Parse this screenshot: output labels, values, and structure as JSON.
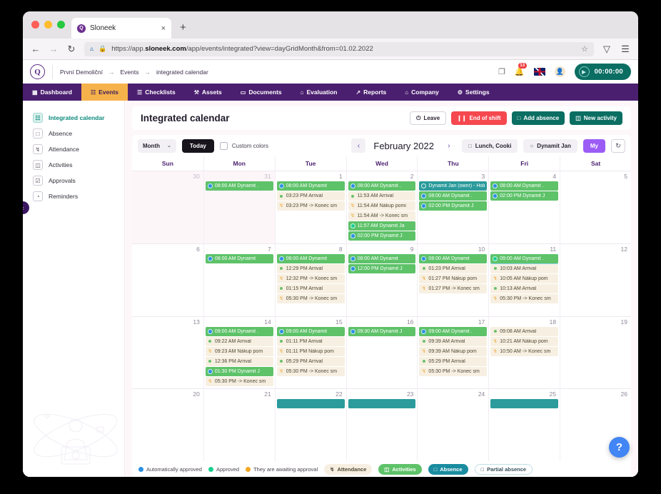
{
  "browser": {
    "tab_title": "Sloneek",
    "tab_close": "×",
    "new_tab": "+",
    "back": "←",
    "forward": "→",
    "reload": "↻",
    "url_prefix": "https://app.",
    "url_domain": "sloneek.com",
    "url_suffix": "/app/events/integrated?view=dayGridMonth&from=01.02.2022",
    "star": "☆",
    "pocket": "▽",
    "menu": "☰"
  },
  "appbar": {
    "logo": "Q",
    "breadcrumbs": [
      "První Demoliční",
      "Events",
      "integrated calendar"
    ],
    "arrow": "→",
    "chat_icon": "❐",
    "bell_icon": "△",
    "bell_badge": "13",
    "timer_value": "00:00:00",
    "play_icon": "▶"
  },
  "mainnav": [
    {
      "label": "Dashboard",
      "icon": "▦",
      "active": false
    },
    {
      "label": "Events",
      "icon": "☷",
      "active": true
    },
    {
      "label": "Checklists",
      "icon": "☰",
      "active": false
    },
    {
      "label": "Assets",
      "icon": "⚒",
      "active": false
    },
    {
      "label": "Documents",
      "icon": "▭",
      "active": false
    },
    {
      "label": "Evaluation",
      "icon": "⌂",
      "active": false
    },
    {
      "label": "Reports",
      "icon": "↗",
      "active": false
    },
    {
      "label": "Company",
      "icon": "⌂",
      "active": false
    },
    {
      "label": "Settings",
      "icon": "⚙",
      "active": false
    }
  ],
  "sidebar": {
    "items": [
      {
        "label": "Integrated calendar",
        "icon": "☷",
        "active": true
      },
      {
        "label": "Absence",
        "icon": "□",
        "active": false
      },
      {
        "label": "Attendance",
        "icon": "↯",
        "active": false
      },
      {
        "label": "Activities",
        "icon": "◫",
        "active": false
      },
      {
        "label": "Approvals",
        "icon": "☑",
        "active": false
      },
      {
        "label": "Reminders",
        "icon": "◔",
        "active": false
      }
    ],
    "collapse_icon": "‹"
  },
  "header": {
    "title": "Integrated calendar",
    "buttons": [
      {
        "label": "Leave",
        "icon": "⏻",
        "style": "outline"
      },
      {
        "label": "End of shift",
        "icon": "❙❙",
        "style": "red"
      },
      {
        "label": "Add absence",
        "icon": "□",
        "style": "teal"
      },
      {
        "label": "New activity",
        "icon": "◫",
        "style": "teal"
      }
    ]
  },
  "toolbar": {
    "view_select": "Month",
    "chevron": "⌄",
    "today_label": "Today",
    "custom_colors_label": "Custom colors",
    "prev_icon": "‹",
    "next_icon": "›",
    "month_label": "February 2022",
    "filter_pills": [
      {
        "label": "Lunch, Cooki",
        "icon": "□"
      },
      {
        "label": "Dynamit Jan",
        "icon": "○"
      }
    ],
    "my_label": "My",
    "refresh_icon": "↻"
  },
  "calendar": {
    "day_headers": [
      "Sun",
      "Mon",
      "Tue",
      "Wed",
      "Thu",
      "Fri",
      "Sat"
    ],
    "weeks": [
      {
        "days": [
          {
            "num": "30",
            "other": true,
            "events": []
          },
          {
            "num": "31",
            "other": true,
            "events": [
              {
                "type": "activity",
                "marker": "blue",
                "text": "08:00 AM Dynamit ."
              }
            ]
          },
          {
            "num": "1",
            "other": false,
            "events": [
              {
                "type": "activity",
                "marker": "blue",
                "text": "08:00 AM Dynamit"
              },
              {
                "type": "attend",
                "marker": "dotg",
                "text": "03:23 PM Arrival"
              },
              {
                "type": "attend",
                "marker": "run",
                "text": "03:23 PM -> Konec sm"
              }
            ]
          },
          {
            "num": "2",
            "other": false,
            "events": [
              {
                "type": "activity",
                "marker": "blue",
                "text": "08:00 AM Dynamit ."
              },
              {
                "type": "attend",
                "marker": "dotg",
                "text": "11:53 AM Arrival"
              },
              {
                "type": "attend",
                "marker": "run",
                "text": "11:54 AM Nákup pomi"
              },
              {
                "type": "attend",
                "marker": "run",
                "text": "11:54 AM -> Konec sm"
              },
              {
                "type": "activity",
                "marker": "green",
                "text": "11:57 AM Dynamit Ja"
              },
              {
                "type": "activity",
                "marker": "blue",
                "text": "02:00 PM Dynamit J"
              }
            ]
          },
          {
            "num": "3",
            "other": false,
            "events": [
              {
                "type": "absence",
                "marker": "hollow",
                "text": "Dynamit Jan (ownr) - Holiday"
              },
              {
                "type": "activity",
                "marker": "blue",
                "text": "08:00 AM Dynamit ."
              },
              {
                "type": "activity",
                "marker": "blue",
                "text": "02:00 PM Dynamit J"
              }
            ]
          },
          {
            "num": "4",
            "other": false,
            "events": [
              {
                "type": "activity",
                "marker": "blue",
                "text": "08:00 AM Dynamit ."
              },
              {
                "type": "activity",
                "marker": "blue",
                "text": "02:00 PM Dynamit J"
              }
            ]
          },
          {
            "num": "5",
            "other": false,
            "events": []
          }
        ]
      },
      {
        "days": [
          {
            "num": "6",
            "other": false,
            "events": []
          },
          {
            "num": "7",
            "other": false,
            "events": [
              {
                "type": "activity",
                "marker": "blue",
                "text": "08:00 AM Dynamit"
              }
            ]
          },
          {
            "num": "8",
            "other": false,
            "events": [
              {
                "type": "activity",
                "marker": "blue",
                "text": "08:00 AM Dynamit"
              },
              {
                "type": "attend",
                "marker": "dotg",
                "text": "12:29 PM Arrival"
              },
              {
                "type": "attend",
                "marker": "run",
                "text": "12:32 PM -> Konec sm"
              },
              {
                "type": "attend",
                "marker": "dotg",
                "text": "01:15 PM Arrival"
              },
              {
                "type": "attend",
                "marker": "run",
                "text": "05:30 PM -> Konec sm"
              }
            ]
          },
          {
            "num": "9",
            "other": false,
            "events": [
              {
                "type": "activity",
                "marker": "blue",
                "text": "08:00 AM Dynamit"
              },
              {
                "type": "activity",
                "marker": "blue",
                "text": "12:00 PM Dynamit J"
              }
            ]
          },
          {
            "num": "10",
            "other": false,
            "events": [
              {
                "type": "activity",
                "marker": "blue",
                "text": "08:00 AM Dynamit"
              },
              {
                "type": "attend",
                "marker": "dotg",
                "text": "01:23 PM Arrival"
              },
              {
                "type": "attend",
                "marker": "run",
                "text": "01:27 PM Nákup pom"
              },
              {
                "type": "attend",
                "marker": "run",
                "text": "01:27 PM -> Konec sm"
              }
            ]
          },
          {
            "num": "11",
            "other": false,
            "events": [
              {
                "type": "activity",
                "marker": "green",
                "text": "09:00 AM Dynamit .",
                "selected": true
              },
              {
                "type": "attend",
                "marker": "dotg",
                "text": "10:03 AM Arrival"
              },
              {
                "type": "attend",
                "marker": "run",
                "text": "10:05 AM Nákup pom"
              },
              {
                "type": "attend",
                "marker": "dotg",
                "text": "10:13 AM Arrival"
              },
              {
                "type": "attend",
                "marker": "run",
                "text": "05:30 PM -> Konec sm"
              }
            ]
          },
          {
            "num": "12",
            "other": false,
            "events": []
          }
        ]
      },
      {
        "days": [
          {
            "num": "13",
            "other": false,
            "events": []
          },
          {
            "num": "14",
            "other": false,
            "events": [
              {
                "type": "activity",
                "marker": "blue",
                "text": "09:00 AM Dynamit ."
              },
              {
                "type": "attend",
                "marker": "dotg",
                "text": "09:22 AM Arrival"
              },
              {
                "type": "attend",
                "marker": "run",
                "text": "09:23 AM Nákup pom"
              },
              {
                "type": "attend",
                "marker": "dotg",
                "text": "12:36 PM Arrival"
              },
              {
                "type": "activity",
                "marker": "blue",
                "text": "01:30 PM Dynamit J"
              },
              {
                "type": "attend",
                "marker": "run",
                "text": "05:30 PM -> Konec sm"
              }
            ]
          },
          {
            "num": "15",
            "other": false,
            "events": [
              {
                "type": "activity",
                "marker": "blue",
                "text": "09:00 AM Dynamit"
              },
              {
                "type": "attend",
                "marker": "dotg",
                "text": "01:11 PM Arrival"
              },
              {
                "type": "attend",
                "marker": "run",
                "text": "01:11 PM Nákup pom"
              },
              {
                "type": "attend",
                "marker": "dotg",
                "text": "05:29 PM Arrival"
              },
              {
                "type": "attend",
                "marker": "run",
                "text": "05:30 PM -> Konec sm"
              }
            ]
          },
          {
            "num": "16",
            "other": false,
            "events": [
              {
                "type": "activity",
                "marker": "blue",
                "text": "09:30 AM Dynamit J"
              }
            ]
          },
          {
            "num": "17",
            "other": false,
            "events": [
              {
                "type": "activity",
                "marker": "blue",
                "text": "09:00 AM Dynamit ."
              },
              {
                "type": "attend",
                "marker": "dotg",
                "text": "09:39 AM Arrival"
              },
              {
                "type": "attend",
                "marker": "run",
                "text": "09:39 AM Nákup pom"
              },
              {
                "type": "attend",
                "marker": "dotg",
                "text": "05:29 PM Arrival"
              },
              {
                "type": "attend",
                "marker": "run",
                "text": "05:30 PM -> Konec sm"
              }
            ]
          },
          {
            "num": "18",
            "other": false,
            "events": [
              {
                "type": "attend",
                "marker": "dotg",
                "text": "09:08 AM Arrival"
              },
              {
                "type": "attend",
                "marker": "run",
                "text": "10:21 AM Nákup pom"
              },
              {
                "type": "attend",
                "marker": "run",
                "text": "10:50 AM -> Konec sm"
              }
            ]
          },
          {
            "num": "19",
            "other": false,
            "events": []
          }
        ]
      },
      {
        "days": [
          {
            "num": "20",
            "other": false,
            "events": []
          },
          {
            "num": "21",
            "other": false,
            "events": []
          },
          {
            "num": "22",
            "other": false,
            "events": [
              {
                "type": "absence",
                "marker": "none",
                "text": ""
              }
            ]
          },
          {
            "num": "23",
            "other": false,
            "events": [
              {
                "type": "absence",
                "marker": "none",
                "text": ""
              }
            ]
          },
          {
            "num": "24",
            "other": false,
            "events": []
          },
          {
            "num": "25",
            "other": false,
            "events": [
              {
                "type": "absence",
                "marker": "none",
                "text": ""
              }
            ]
          },
          {
            "num": "26",
            "other": false,
            "events": []
          }
        ]
      }
    ]
  },
  "legend": {
    "dots": [
      {
        "label": "Automatically approved",
        "color": "#2a8fe0"
      },
      {
        "label": "Approved",
        "color": "#18cf8e"
      },
      {
        "label": "They are awaiting approval",
        "color": "#f5a623"
      }
    ],
    "pills": [
      {
        "label": "Attendance",
        "icon": "↯",
        "style": "att"
      },
      {
        "label": "Activities",
        "icon": "◫",
        "style": "act"
      },
      {
        "label": "Absence",
        "icon": "□",
        "style": "abs"
      },
      {
        "label": "Partial absence",
        "icon": "□",
        "style": "part"
      }
    ]
  },
  "help": {
    "icon": "?"
  }
}
